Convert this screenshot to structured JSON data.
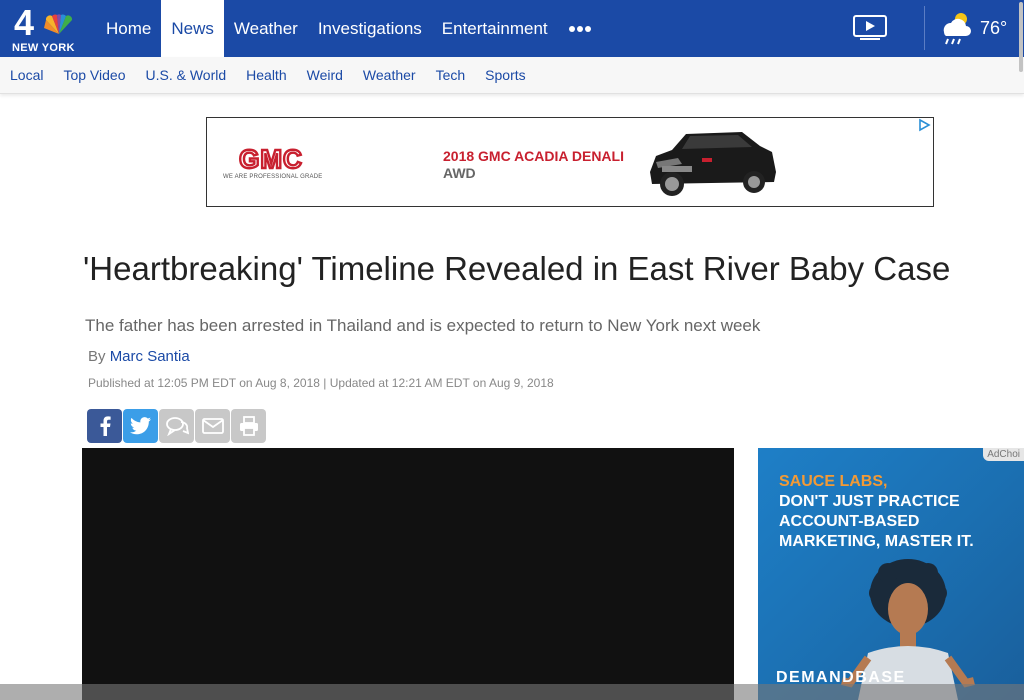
{
  "brand": {
    "logo_number": "4",
    "logo_city": "NEW YORK"
  },
  "nav": {
    "items": [
      {
        "label": "Home",
        "active": false
      },
      {
        "label": "News",
        "active": true
      },
      {
        "label": "Weather",
        "active": false
      },
      {
        "label": "Investigations",
        "active": false
      },
      {
        "label": "Entertainment",
        "active": false
      }
    ],
    "more_icon": "more-dots-icon",
    "video_icon": "play-video-icon",
    "weather_icon": "rain-sun-icon",
    "temperature": "76°"
  },
  "subnav": {
    "items": [
      "Local",
      "Top Video",
      "U.S. & World",
      "Health",
      "Weird",
      "Weather",
      "Tech",
      "Sports"
    ]
  },
  "top_ad": {
    "brand": "GMC",
    "tagline": "WE ARE PROFESSIONAL GRADE",
    "line1": "2018 GMC ACADIA DENALI",
    "line2": "AWD",
    "adchoices_icon": "adchoices-icon"
  },
  "article": {
    "headline": "'Heartbreaking' Timeline Revealed in East River Baby Case",
    "subhead": "The father has been arrested in Thailand and is expected to return to New York next week",
    "by_prefix": "By",
    "author": "Marc Santia",
    "dates": "Published at 12:05 PM EDT on Aug 8, 2018 | Updated at 12:21 AM EDT on Aug 9, 2018"
  },
  "share": {
    "buttons": [
      "facebook-icon",
      "twitter-icon",
      "comment-icon",
      "email-icon",
      "print-icon"
    ]
  },
  "side_ad": {
    "adchoices": "AdChoi",
    "brand": "SAUCE LABS,",
    "message": "DON'T JUST PRACTICE ACCOUNT-BASED MARKETING, MASTER IT.",
    "footer": "DEMANDBASE"
  },
  "colors": {
    "nav_blue": "#1b4aa6",
    "gmc_red": "#c8202f",
    "fb_blue": "#3b5998",
    "tw_blue": "#3b9ee8",
    "sauce_orange": "#f39a35"
  }
}
